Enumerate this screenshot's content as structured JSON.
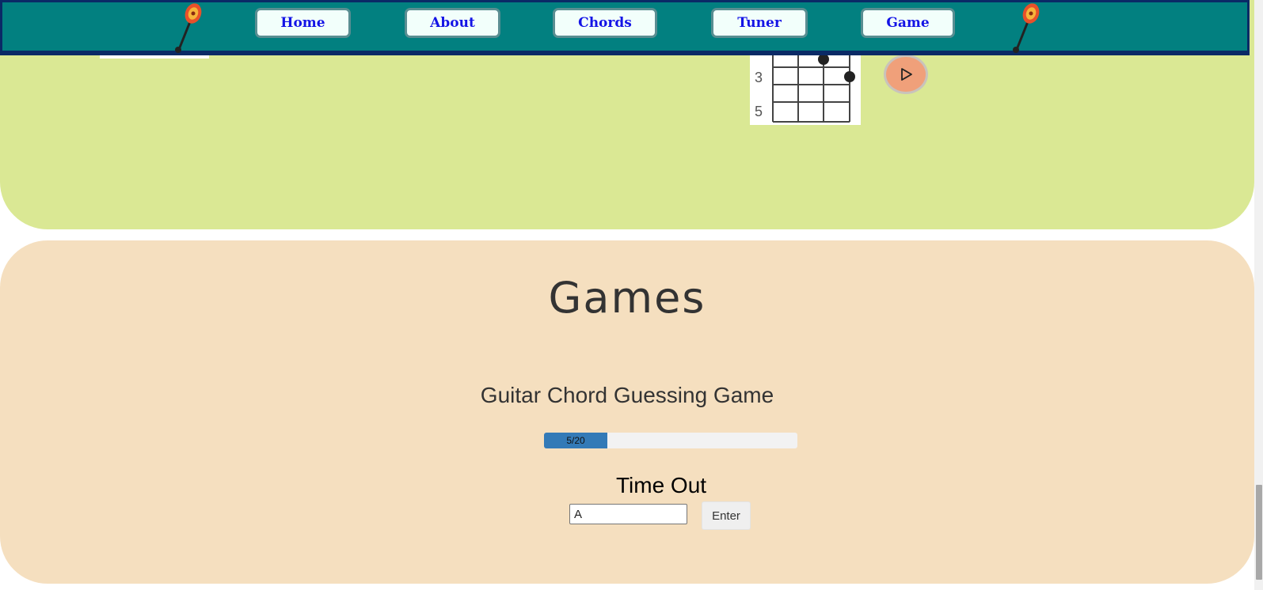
{
  "nav": {
    "items": [
      {
        "label": "Home"
      },
      {
        "label": "About"
      },
      {
        "label": "Chords"
      },
      {
        "label": "Tuner"
      },
      {
        "label": "Game"
      }
    ]
  },
  "chord_diagram": {
    "fret_labels": [
      "3",
      "5"
    ]
  },
  "games": {
    "title": "Games",
    "subtitle": "Guitar Chord Guessing Game",
    "progress": {
      "text": "5/20",
      "current": 5,
      "total": 20
    },
    "status": "Time Out",
    "answer_value": "A",
    "enter_label": "Enter"
  },
  "colors": {
    "nav_bg": "#028080",
    "nav_text": "#1414e6",
    "green_section": "#dae894",
    "tan_section": "#f5dfbf",
    "progress_fill": "#337ab7",
    "play_button": "#f0a07a"
  },
  "icons": {
    "guitar": "guitar-icon",
    "play": "play-icon"
  }
}
